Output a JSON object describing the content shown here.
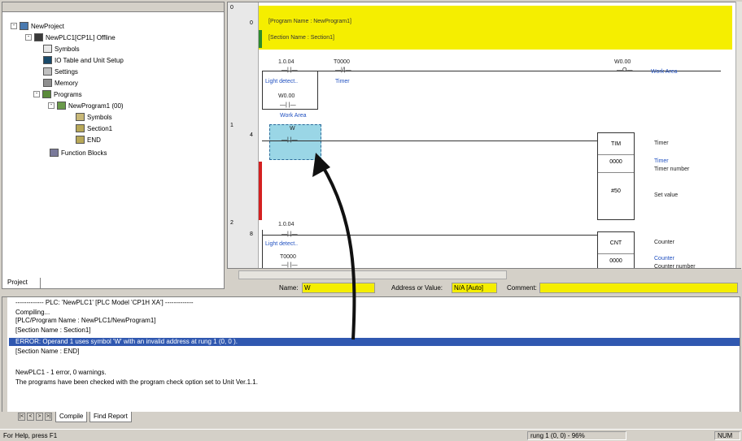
{
  "tree": {
    "items": [
      {
        "label": "NewProject",
        "icon": "project-icon"
      },
      {
        "label": "NewPLC1[CP1L] Offline",
        "icon": "plc-icon"
      },
      {
        "label": "Symbols",
        "icon": "symbols-icon"
      },
      {
        "label": "IO Table and Unit Setup",
        "icon": "io-table-icon"
      },
      {
        "label": "Settings",
        "icon": "settings-icon"
      },
      {
        "label": "Memory",
        "icon": "memory-icon"
      },
      {
        "label": "Programs",
        "icon": "programs-icon"
      },
      {
        "label": "NewProgram1 (00)",
        "icon": "program-icon"
      },
      {
        "label": "Symbols",
        "icon": "symbols-icon"
      },
      {
        "label": "Section1",
        "icon": "section-icon"
      },
      {
        "label": "END",
        "icon": "end-icon"
      },
      {
        "label": "Function Blocks",
        "icon": "function-blocks-icon"
      }
    ],
    "tab_label": "Project"
  },
  "ladder": {
    "rung_numbers": [
      "0",
      "1",
      "2"
    ],
    "step_numbers": [
      "0",
      "4",
      "8"
    ],
    "header_program": "[Program Name : NewProgram1]",
    "header_section": "[Section Name : Section1]",
    "rung0": {
      "contact1_addr": "1.0.04",
      "contact1_comment": "Light detect..",
      "contact2_addr": "T0000",
      "contact2_comment": "Timer",
      "branch_addr": "W0.00",
      "branch_comment": "Work Area",
      "coil_addr": "W0.00",
      "coil_comment": "Work Area"
    },
    "rung1": {
      "contact_addr": "W",
      "box_title": "TIM",
      "box_num": "0000",
      "box_set": "#50",
      "lbl_timer": "Timer",
      "lbl_timer2": "Timer",
      "lbl_timer_number": "Timer number",
      "lbl_set_value": "Set value"
    },
    "rung2": {
      "contact1_addr": "1.0.04",
      "contact1_comment": "Light detect..",
      "contact2_addr": "T0000",
      "box_title": "CNT",
      "box_num": "0000",
      "lbl_counter": "Counter",
      "lbl_counter2": "Counter",
      "lbl_counter_number": "Counter number"
    }
  },
  "name_bar": {
    "name_label": "Name:",
    "name_value": "W",
    "address_label": "Address or Value:",
    "address_value": "N/A [Auto]",
    "comment_label": "Comment:",
    "comment_value": ""
  },
  "output": {
    "lines": [
      "------------- PLC: 'NewPLC1' [PLC Model 'CP1H XA'] -------------",
      "Compiling...",
      "[PLC/Program Name : NewPLC1/NewProgram1]",
      "[Section Name : Section1]",
      "ERROR: Operand 1 uses symbol 'W' with an invalid address at rung 1 (0, 0 ).",
      "[Section Name : END]",
      "",
      "NewPLC1 - 1 error, 0 warnings.",
      "The programs have been checked with the program check option set to Unit Ver.1.1."
    ],
    "tabs": [
      "Compile",
      "Find Report"
    ]
  },
  "status": {
    "help": "For Help, press F1",
    "position": "rung 1 (0, 0) - 96%",
    "num": "NUM"
  },
  "colors": {
    "header_yellow": "#f5ee00",
    "selection_cyan": "#9ad6e6",
    "error_blue": "#3058b0",
    "error_bar_red": "#d42020"
  }
}
